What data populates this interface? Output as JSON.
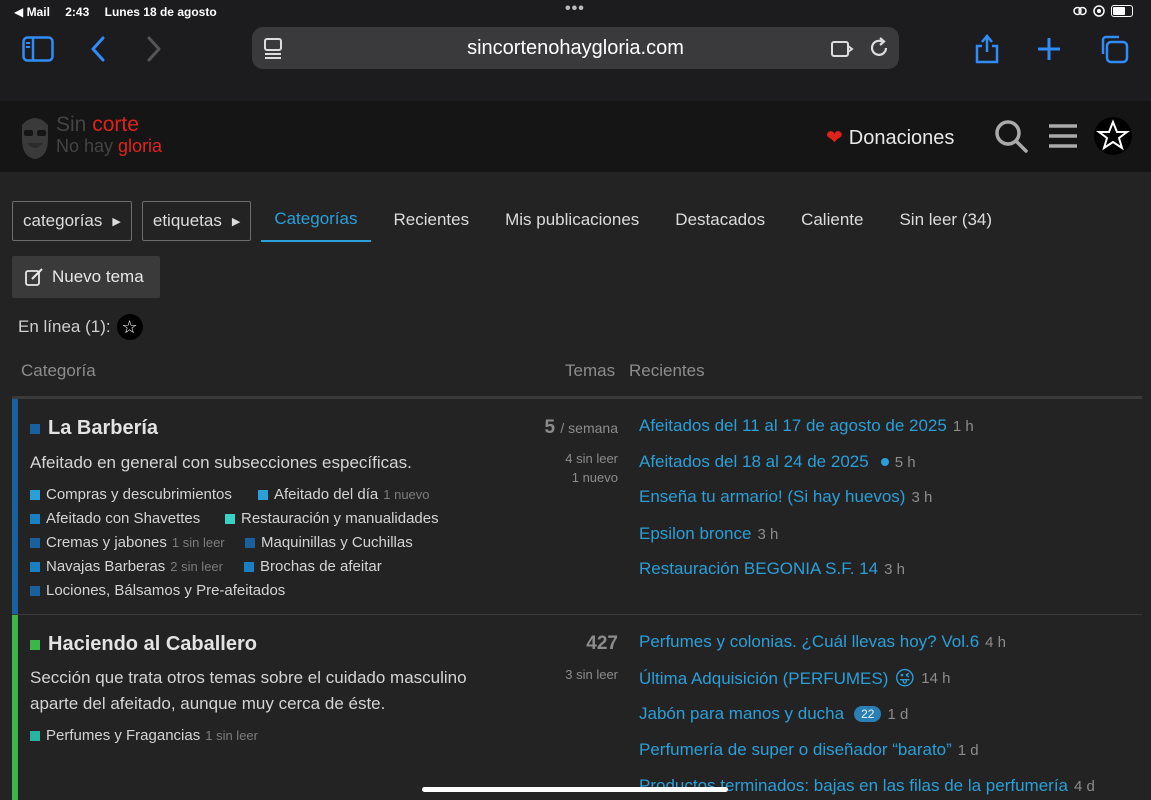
{
  "status": {
    "back_app": "◀ Mail",
    "time": "2:43",
    "date": "Lunes 18 de agosto"
  },
  "browser": {
    "url": "sincortenohaygloria.com"
  },
  "site": {
    "logo_line1_a": "Sin ",
    "logo_line1_b": "corte",
    "logo_line2_a": "No hay ",
    "logo_line2_b": "gloria",
    "donate_label": "Donaciones"
  },
  "nav": {
    "dropdowns": [
      "categorías",
      "etiquetas"
    ],
    "tabs": [
      "Categorías",
      "Recientes",
      "Mis publicaciones",
      "Destacados",
      "Caliente",
      "Sin leer (34)"
    ],
    "new_topic": "Nuevo tema",
    "online": "En línea (1):"
  },
  "table": {
    "col_category": "Categoría",
    "col_topics": "Temas",
    "col_recent": "Recientes"
  },
  "categories": [
    {
      "name": "La Barbería",
      "color": "#1a5f9e",
      "description": "Afeitado en general con subsecciones específicas.",
      "topics_count": "5",
      "topics_unit": "/ semana",
      "stat1": "4 sin leer",
      "stat2": "1 nuevo",
      "subcategories": [
        {
          "name": "Compras y descubrimientos",
          "meta": "",
          "color": "#2a9fd8"
        },
        {
          "name": "Afeitado del día",
          "meta": "1 nuevo",
          "color": "#2a9fd8"
        },
        {
          "name": "Afeitado con Shavettes",
          "meta": "",
          "color": "#1a7fc0"
        },
        {
          "name": "Restauración y manualidades",
          "meta": "",
          "color": "#3ad1c5"
        },
        {
          "name": "Cremas y jabones",
          "meta": "1 sin leer",
          "color": "#1a5f9e"
        },
        {
          "name": "Maquinillas y Cuchillas",
          "meta": "",
          "color": "#1a5f9e"
        },
        {
          "name": "Navajas Barberas",
          "meta": "2 sin leer",
          "color": "#1a7fc0"
        },
        {
          "name": "Brochas de afeitar",
          "meta": "",
          "color": "#1a7fc0"
        },
        {
          "name": "Lociones, Bálsamos y Pre-afeitados",
          "meta": "",
          "color": "#1a5f9e"
        }
      ],
      "recent": [
        {
          "title": "Afeitados del 11 al 17 de agosto de 2025",
          "age": "1 h"
        },
        {
          "title": "Afeitados del 18 al 24 de 2025",
          "age": "5 h"
        },
        {
          "title": "Enseña tu armario! (Si hay huevos)",
          "age": "3 h"
        },
        {
          "title": "Epsilon bronce",
          "age": "3 h"
        },
        {
          "title": "Restauración BEGONIA S.F. 14",
          "age": "3 h"
        }
      ]
    },
    {
      "name": "Haciendo al Caballero",
      "color": "#3cb54a",
      "description": "Sección que trata otros temas sobre el cuidado masculino aparte del afeitado, aunque muy cerca de éste.",
      "topics_count": "427",
      "stat1": "3 sin leer",
      "subcategories": [
        {
          "name": "Perfumes y Fragancias",
          "meta": "1 sin leer",
          "color": "#26b5a5"
        }
      ],
      "recent": [
        {
          "title": "Perfumes y colonias. ¿Cuál llevas hoy? Vol.6",
          "age": "4 h"
        },
        {
          "title": "Última Adquisición (PERFUMES)",
          "emoji": "😜",
          "age": "14 h"
        },
        {
          "title": "Jabón para manos y ducha",
          "badge": "22",
          "age": "1 d"
        },
        {
          "title": "Perfumería de super o diseñador “barato”",
          "age": "1 d"
        },
        {
          "title": "Productos terminados: bajas en las filas de la perfumería",
          "age": "4 d"
        }
      ]
    }
  ]
}
